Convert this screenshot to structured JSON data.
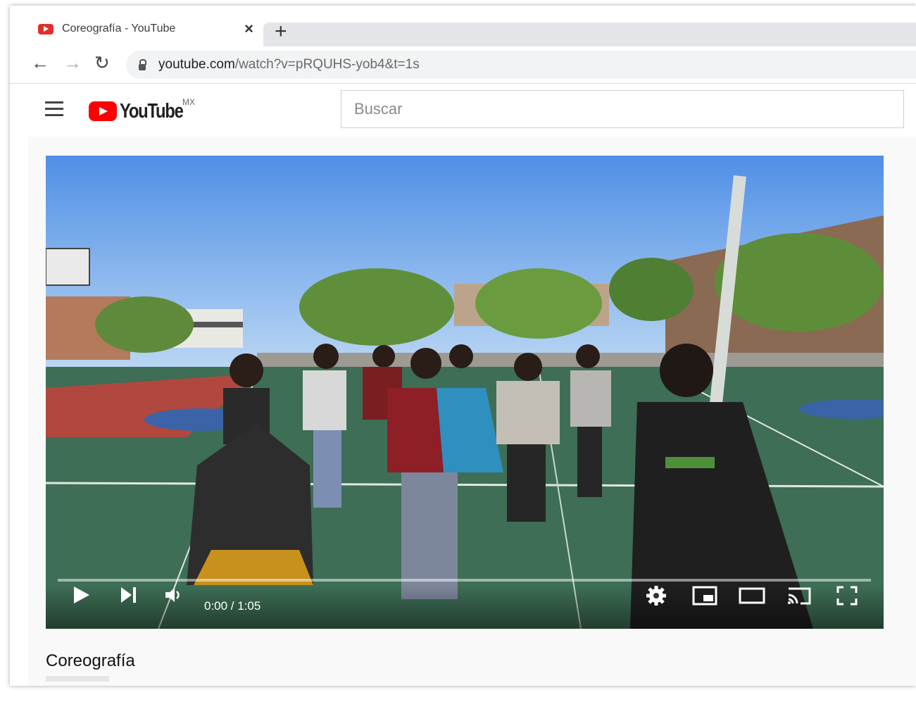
{
  "browser": {
    "tab_title": "Coreografía - YouTube",
    "close_glyph": "×",
    "new_tab_glyph": "+",
    "back_glyph": "←",
    "forward_glyph": "→",
    "reload_glyph": "↻",
    "url_host": "youtube.com",
    "url_path": "/watch?v=pRQUHS-yob4&t=1s"
  },
  "youtube": {
    "logo_text": "YouTube",
    "country_code": "MX",
    "search_placeholder": "Buscar"
  },
  "player": {
    "time": "0:00 / 1:05",
    "progress_fraction": 0.0,
    "icons": [
      "play-icon",
      "next-icon",
      "volume-icon",
      "settings-icon",
      "miniplayer-icon",
      "theater-icon",
      "cast-icon",
      "fullscreen-icon"
    ]
  },
  "video": {
    "title": "Coreografía"
  },
  "colors": {
    "youtube_red": "#ff0000",
    "sky": "#6aa3e8",
    "court_green": "#3e6e55"
  }
}
